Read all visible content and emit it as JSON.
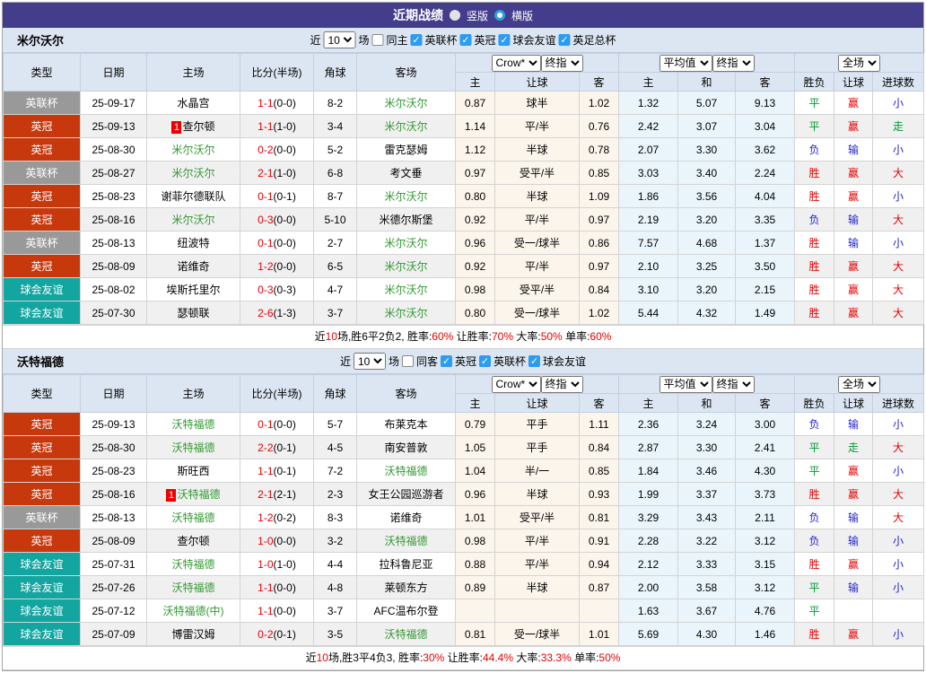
{
  "title_bar": {
    "title": "近期战绩",
    "radio_vertical": "竖版",
    "radio_horizontal": "横版"
  },
  "colors": {
    "titlebar_bg": "#433d8b",
    "header_bg": "#dce6f2",
    "badge_cup": "#999999",
    "badge_championship": "#c8380d",
    "badge_friendly": "#13a5a0",
    "focus_team_green": "#339933",
    "win_red": "#e60000",
    "draw_green": "#009933",
    "lose_blue": "#2525cd",
    "crow_col_bg": "#fcf5ec",
    "avg_col_bg": "#e9f5fa",
    "checkbox_blue": "#2b9cf2"
  },
  "header": {
    "col_type": "类型",
    "col_date": "日期",
    "col_home": "主场",
    "col_score": "比分(半场)",
    "col_corner": "角球",
    "col_away": "客场",
    "dd_crow": "Crow*",
    "dd_final": "终指",
    "dd_avg": "平均值",
    "dd_full": "全场",
    "sub_cols": [
      "主",
      "让球",
      "客",
      "主",
      "和",
      "客",
      "胜负",
      "让球",
      "进球数"
    ]
  },
  "filter_common": {
    "near": "近",
    "count": "10",
    "matches_label": "场"
  },
  "sections": [
    {
      "team": "米尔沃尔",
      "filter": {
        "same_label": "同主",
        "same_checked": false,
        "leagues": [
          "英联杯",
          "英冠",
          "球会友谊",
          "英足总杯"
        ]
      },
      "rows": [
        {
          "league": "英联杯",
          "type": "cup",
          "date": "25-09-17",
          "home": "水晶宫",
          "home_focus": false,
          "home_badge": "",
          "score": "1-1",
          "half": "(0-0)",
          "corners": "8-2",
          "away": "米尔沃尔",
          "away_focus": true,
          "handicap": [
            "0.87",
            "球半",
            "1.02"
          ],
          "avg": [
            "1.32",
            "5.07",
            "9.13"
          ],
          "results": [
            [
              "平",
              "g"
            ],
            [
              "赢",
              "r"
            ],
            [
              "小",
              "b"
            ]
          ]
        },
        {
          "league": "英冠",
          "type": "champ",
          "date": "25-09-13",
          "home": "查尔顿",
          "home_focus": false,
          "home_badge": "1",
          "score": "1-1",
          "half": "(1-0)",
          "corners": "3-4",
          "away": "米尔沃尔",
          "away_focus": true,
          "handicap": [
            "1.14",
            "平/半",
            "0.76"
          ],
          "avg": [
            "2.42",
            "3.07",
            "3.04"
          ],
          "results": [
            [
              "平",
              "g"
            ],
            [
              "赢",
              "r"
            ],
            [
              "走",
              "g"
            ]
          ]
        },
        {
          "league": "英冠",
          "type": "champ",
          "date": "25-08-30",
          "home": "米尔沃尔",
          "home_focus": true,
          "home_badge": "",
          "score": "0-2",
          "half": "(0-0)",
          "corners": "5-2",
          "away": "雷克瑟姆",
          "away_focus": false,
          "handicap": [
            "1.12",
            "半球",
            "0.78"
          ],
          "avg": [
            "2.07",
            "3.30",
            "3.62"
          ],
          "results": [
            [
              "负",
              "b"
            ],
            [
              "输",
              "b"
            ],
            [
              "小",
              "b"
            ]
          ]
        },
        {
          "league": "英联杯",
          "type": "cup",
          "date": "25-08-27",
          "home": "米尔沃尔",
          "home_focus": true,
          "home_badge": "",
          "score": "2-1",
          "half": "(1-0)",
          "corners": "6-8",
          "away": "考文垂",
          "away_focus": false,
          "handicap": [
            "0.97",
            "受平/半",
            "0.85"
          ],
          "avg": [
            "3.03",
            "3.40",
            "2.24"
          ],
          "results": [
            [
              "胜",
              "r"
            ],
            [
              "赢",
              "r"
            ],
            [
              "大",
              "r"
            ]
          ]
        },
        {
          "league": "英冠",
          "type": "champ",
          "date": "25-08-23",
          "home": "谢菲尔德联队",
          "home_focus": false,
          "home_badge": "",
          "score": "0-1",
          "half": "(0-1)",
          "corners": "8-7",
          "away": "米尔沃尔",
          "away_focus": true,
          "handicap": [
            "0.80",
            "半球",
            "1.09"
          ],
          "avg": [
            "1.86",
            "3.56",
            "4.04"
          ],
          "results": [
            [
              "胜",
              "r"
            ],
            [
              "赢",
              "r"
            ],
            [
              "小",
              "b"
            ]
          ]
        },
        {
          "league": "英冠",
          "type": "champ",
          "date": "25-08-16",
          "home": "米尔沃尔",
          "home_focus": true,
          "home_badge": "",
          "score": "0-3",
          "half": "(0-0)",
          "corners": "5-10",
          "away": "米德尔斯堡",
          "away_focus": false,
          "handicap": [
            "0.92",
            "平/半",
            "0.97"
          ],
          "avg": [
            "2.19",
            "3.20",
            "3.35"
          ],
          "results": [
            [
              "负",
              "b"
            ],
            [
              "输",
              "b"
            ],
            [
              "大",
              "r"
            ]
          ]
        },
        {
          "league": "英联杯",
          "type": "cup",
          "date": "25-08-13",
          "home": "纽波特",
          "home_focus": false,
          "home_badge": "",
          "score": "0-1",
          "half": "(0-0)",
          "corners": "2-7",
          "away": "米尔沃尔",
          "away_focus": true,
          "handicap": [
            "0.96",
            "受一/球半",
            "0.86"
          ],
          "avg": [
            "7.57",
            "4.68",
            "1.37"
          ],
          "results": [
            [
              "胜",
              "r"
            ],
            [
              "输",
              "b"
            ],
            [
              "小",
              "b"
            ]
          ]
        },
        {
          "league": "英冠",
          "type": "champ",
          "date": "25-08-09",
          "home": "诺维奇",
          "home_focus": false,
          "home_badge": "",
          "score": "1-2",
          "half": "(0-0)",
          "corners": "6-5",
          "away": "米尔沃尔",
          "away_focus": true,
          "handicap": [
            "0.92",
            "平/半",
            "0.97"
          ],
          "avg": [
            "2.10",
            "3.25",
            "3.50"
          ],
          "results": [
            [
              "胜",
              "r"
            ],
            [
              "赢",
              "r"
            ],
            [
              "大",
              "r"
            ]
          ]
        },
        {
          "league": "球会友谊",
          "type": "frnd",
          "date": "25-08-02",
          "home": "埃斯托里尔",
          "home_focus": false,
          "home_badge": "",
          "score": "0-3",
          "half": "(0-3)",
          "corners": "4-7",
          "away": "米尔沃尔",
          "away_focus": true,
          "handicap": [
            "0.98",
            "受平/半",
            "0.84"
          ],
          "avg": [
            "3.10",
            "3.20",
            "2.15"
          ],
          "results": [
            [
              "胜",
              "r"
            ],
            [
              "赢",
              "r"
            ],
            [
              "大",
              "r"
            ]
          ]
        },
        {
          "league": "球会友谊",
          "type": "frnd",
          "date": "25-07-30",
          "home": "瑟顿联",
          "home_focus": false,
          "home_badge": "",
          "score": "2-6",
          "half": "(1-3)",
          "corners": "3-7",
          "away": "米尔沃尔",
          "away_focus": true,
          "handicap": [
            "0.80",
            "受一/球半",
            "1.02"
          ],
          "avg": [
            "5.44",
            "4.32",
            "1.49"
          ],
          "results": [
            [
              "胜",
              "r"
            ],
            [
              "赢",
              "r"
            ],
            [
              "大",
              "r"
            ]
          ]
        }
      ],
      "summary": [
        [
          "近",
          false
        ],
        [
          "10",
          true
        ],
        [
          "场,胜6平2负2, 胜率:",
          false
        ],
        [
          "60%",
          true
        ],
        [
          " 让胜率:",
          false
        ],
        [
          "70%",
          true
        ],
        [
          " 大率:",
          false
        ],
        [
          "50%",
          true
        ],
        [
          " 单率:",
          false
        ],
        [
          "60%",
          true
        ]
      ]
    },
    {
      "team": "沃特福德",
      "filter": {
        "same_label": "同客",
        "same_checked": false,
        "leagues": [
          "英冠",
          "英联杯",
          "球会友谊"
        ]
      },
      "rows": [
        {
          "league": "英冠",
          "type": "champ",
          "date": "25-09-13",
          "home": "沃特福德",
          "home_focus": true,
          "home_badge": "",
          "score": "0-1",
          "half": "(0-0)",
          "corners": "5-7",
          "away": "布莱克本",
          "away_focus": false,
          "handicap": [
            "0.79",
            "平手",
            "1.11"
          ],
          "avg": [
            "2.36",
            "3.24",
            "3.00"
          ],
          "results": [
            [
              "负",
              "b"
            ],
            [
              "输",
              "b"
            ],
            [
              "小",
              "b"
            ]
          ]
        },
        {
          "league": "英冠",
          "type": "champ",
          "date": "25-08-30",
          "home": "沃特福德",
          "home_focus": true,
          "home_badge": "",
          "score": "2-2",
          "half": "(0-1)",
          "corners": "4-5",
          "away": "南安普敦",
          "away_focus": false,
          "handicap": [
            "1.05",
            "平手",
            "0.84"
          ],
          "avg": [
            "2.87",
            "3.30",
            "2.41"
          ],
          "results": [
            [
              "平",
              "g"
            ],
            [
              "走",
              "g"
            ],
            [
              "大",
              "r"
            ]
          ]
        },
        {
          "league": "英冠",
          "type": "champ",
          "date": "25-08-23",
          "home": "斯旺西",
          "home_focus": false,
          "home_badge": "",
          "score": "1-1",
          "half": "(0-1)",
          "corners": "7-2",
          "away": "沃特福德",
          "away_focus": true,
          "handicap": [
            "1.04",
            "半/一",
            "0.85"
          ],
          "avg": [
            "1.84",
            "3.46",
            "4.30"
          ],
          "results": [
            [
              "平",
              "g"
            ],
            [
              "赢",
              "r"
            ],
            [
              "小",
              "b"
            ]
          ]
        },
        {
          "league": "英冠",
          "type": "champ",
          "date": "25-08-16",
          "home": "沃特福德",
          "home_focus": true,
          "home_badge": "1",
          "score": "2-1",
          "half": "(2-1)",
          "corners": "2-3",
          "away": "女王公园巡游者",
          "away_focus": false,
          "handicap": [
            "0.96",
            "半球",
            "0.93"
          ],
          "avg": [
            "1.99",
            "3.37",
            "3.73"
          ],
          "results": [
            [
              "胜",
              "r"
            ],
            [
              "赢",
              "r"
            ],
            [
              "大",
              "r"
            ]
          ]
        },
        {
          "league": "英联杯",
          "type": "cup",
          "date": "25-08-13",
          "home": "沃特福德",
          "home_focus": true,
          "home_badge": "",
          "score": "1-2",
          "half": "(0-2)",
          "corners": "8-3",
          "away": "诺维奇",
          "away_focus": false,
          "handicap": [
            "1.01",
            "受平/半",
            "0.81"
          ],
          "avg": [
            "3.29",
            "3.43",
            "2.11"
          ],
          "results": [
            [
              "负",
              "b"
            ],
            [
              "输",
              "b"
            ],
            [
              "大",
              "r"
            ]
          ]
        },
        {
          "league": "英冠",
          "type": "champ",
          "date": "25-08-09",
          "home": "查尔顿",
          "home_focus": false,
          "home_badge": "",
          "score": "1-0",
          "half": "(0-0)",
          "corners": "3-2",
          "away": "沃特福德",
          "away_focus": true,
          "handicap": [
            "0.98",
            "平/半",
            "0.91"
          ],
          "avg": [
            "2.28",
            "3.22",
            "3.12"
          ],
          "results": [
            [
              "负",
              "b"
            ],
            [
              "输",
              "b"
            ],
            [
              "小",
              "b"
            ]
          ]
        },
        {
          "league": "球会友谊",
          "type": "frnd",
          "date": "25-07-31",
          "home": "沃特福德",
          "home_focus": true,
          "home_badge": "",
          "score": "1-0",
          "half": "(1-0)",
          "corners": "4-4",
          "away": "拉科鲁尼亚",
          "away_focus": false,
          "handicap": [
            "0.88",
            "平/半",
            "0.94"
          ],
          "avg": [
            "2.12",
            "3.33",
            "3.15"
          ],
          "results": [
            [
              "胜",
              "r"
            ],
            [
              "赢",
              "r"
            ],
            [
              "小",
              "b"
            ]
          ]
        },
        {
          "league": "球会友谊",
          "type": "frnd",
          "date": "25-07-26",
          "home": "沃特福德",
          "home_focus": true,
          "home_badge": "",
          "score": "1-1",
          "half": "(0-0)",
          "corners": "4-8",
          "away": "莱顿东方",
          "away_focus": false,
          "handicap": [
            "0.89",
            "半球",
            "0.87"
          ],
          "avg": [
            "2.00",
            "3.58",
            "3.12"
          ],
          "results": [
            [
              "平",
              "g"
            ],
            [
              "输",
              "b"
            ],
            [
              "小",
              "b"
            ]
          ]
        },
        {
          "league": "球会友谊",
          "type": "frnd",
          "date": "25-07-12",
          "home": "沃特福德(中)",
          "home_focus": true,
          "home_badge": "",
          "score": "1-1",
          "half": "(0-0)",
          "corners": "3-7",
          "away": "AFC温布尔登",
          "away_focus": false,
          "handicap": [
            "",
            "",
            ""
          ],
          "avg": [
            "1.63",
            "3.67",
            "4.76"
          ],
          "results": [
            [
              "平",
              "g"
            ],
            [
              "",
              ""
            ],
            [
              "",
              ""
            ]
          ]
        },
        {
          "league": "球会友谊",
          "type": "frnd",
          "date": "25-07-09",
          "home": "博雷汉姆",
          "home_focus": false,
          "home_badge": "",
          "score": "0-2",
          "half": "(0-1)",
          "corners": "3-5",
          "away": "沃特福德",
          "away_focus": true,
          "handicap": [
            "0.81",
            "受一/球半",
            "1.01"
          ],
          "avg": [
            "5.69",
            "4.30",
            "1.46"
          ],
          "results": [
            [
              "胜",
              "r"
            ],
            [
              "赢",
              "r"
            ],
            [
              "小",
              "b"
            ]
          ]
        }
      ],
      "summary": [
        [
          "近",
          false
        ],
        [
          "10",
          true
        ],
        [
          "场,胜3平4负3, 胜率:",
          false
        ],
        [
          "30%",
          true
        ],
        [
          " 让胜率:",
          false
        ],
        [
          "44.4%",
          true
        ],
        [
          " 大率:",
          false
        ],
        [
          "33.3%",
          true
        ],
        [
          " 单率:",
          false
        ],
        [
          "50%",
          true
        ]
      ]
    }
  ]
}
